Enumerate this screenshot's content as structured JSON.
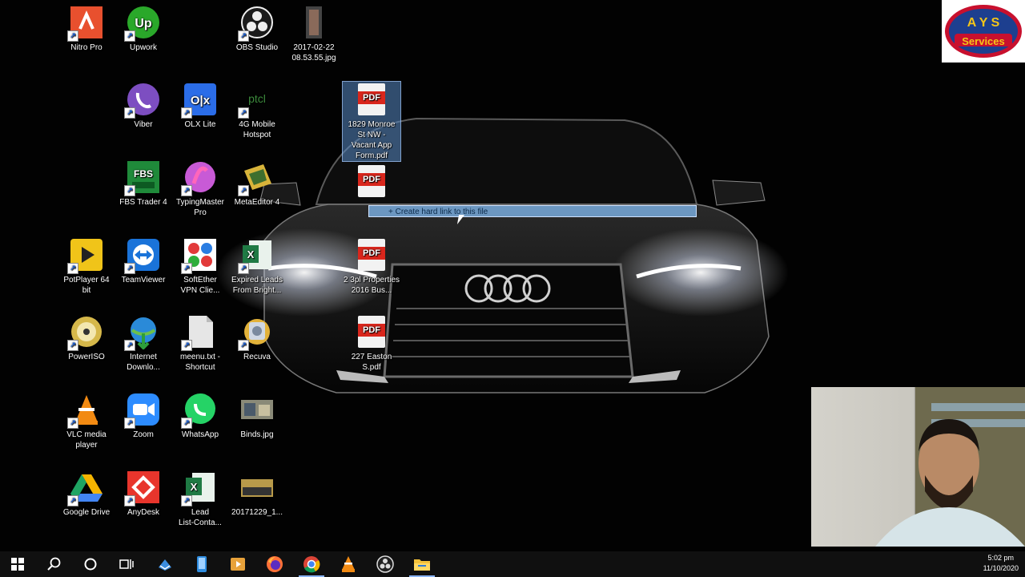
{
  "desktop": {
    "icons": [
      {
        "id": "nitro",
        "label": "Nitro Pro",
        "icon": "nitro-pro-icon",
        "color": "#e8502e"
      },
      {
        "id": "upwork",
        "label": "Upwork",
        "icon": "upwork-icon",
        "color": "#2aa82a"
      },
      {
        "id": "obs",
        "label": "OBS Studio",
        "icon": "obs-studio-icon",
        "color": "#1b1b1b"
      },
      {
        "id": "jpg2017",
        "label": "2017-02-22\n08.53.55.jpg",
        "icon": "image-thumbnail-icon",
        "color": "#444"
      },
      {
        "id": "viber",
        "label": "Viber",
        "icon": "viber-icon",
        "color": "#7d4ec1"
      },
      {
        "id": "olx",
        "label": "OLX Lite",
        "icon": "olx-icon",
        "color": "#2b6de8"
      },
      {
        "id": "ptcl",
        "label": "4G Mobile\nHotspot",
        "icon": "ptcl-hotspot-icon",
        "color": "#3c8a3c"
      },
      {
        "id": "pdf1829",
        "label": "1829 Monroe\nSt NW -\nVacant App\nForm.pdf",
        "icon": "pdf-icon",
        "color": "#d9261c"
      },
      {
        "id": "fbs",
        "label": "FBS Trader 4",
        "icon": "fbs-trader-icon",
        "color": "#1f8a3a"
      },
      {
        "id": "typing",
        "label": "TypingMaster\nPro",
        "icon": "typingmaster-icon",
        "color": "#c85ad6"
      },
      {
        "id": "metaeditor",
        "label": "MetaEditor 4",
        "icon": "metaeditor-icon",
        "color": "#d8b43a"
      },
      {
        "id": "pdf2",
        "label": "",
        "icon": "pdf-icon",
        "color": "#d9261c"
      },
      {
        "id": "potplayer",
        "label": "PotPlayer 64\nbit",
        "icon": "potplayer-icon",
        "color": "#f0c419"
      },
      {
        "id": "teamviewer",
        "label": "TeamViewer",
        "icon": "teamviewer-icon",
        "color": "#1a73d9"
      },
      {
        "id": "softether",
        "label": "SoftEther\nVPN Clie...",
        "icon": "softether-icon",
        "color": "#e23a3a"
      },
      {
        "id": "expired",
        "label": "Expired Leads\nFrom Bright...",
        "icon": "excel-icon",
        "color": "#1f7a44"
      },
      {
        "id": "pdf3",
        "label": "2 3pl Properties\n2016 Bus...",
        "icon": "pdf-icon",
        "color": "#d9261c"
      },
      {
        "id": "poweriso",
        "label": "PowerISO",
        "icon": "poweriso-icon",
        "color": "#d6b84a"
      },
      {
        "id": "idm",
        "label": "Internet\nDownlo...",
        "icon": "internet-download-manager-icon",
        "color": "#2a8ad8"
      },
      {
        "id": "meenu",
        "label": "meenu.txt -\nShortcut",
        "icon": "text-file-icon",
        "color": "#e6e6e6"
      },
      {
        "id": "recuva",
        "label": "Recuva",
        "icon": "recuva-icon",
        "color": "#e2b23a"
      },
      {
        "id": "pdf227",
        "label": "227 Easton\nS.pdf",
        "icon": "pdf-icon",
        "color": "#d9261c"
      },
      {
        "id": "vlc",
        "label": "VLC media\nplayer",
        "icon": "vlc-icon",
        "color": "#f28a12"
      },
      {
        "id": "zoom",
        "label": "Zoom",
        "icon": "zoom-icon",
        "color": "#2d8cff"
      },
      {
        "id": "whatsapp",
        "label": "WhatsApp",
        "icon": "whatsapp-icon",
        "color": "#25d366"
      },
      {
        "id": "binds",
        "label": "Binds.jpg",
        "icon": "image-thumbnail-icon",
        "color": "#8a8a78"
      },
      {
        "id": "gdrive",
        "label": "Google Drive",
        "icon": "google-drive-icon",
        "color": "#f5b400"
      },
      {
        "id": "anydesk",
        "label": "AnyDesk",
        "icon": "anydesk-icon",
        "color": "#e8352c"
      },
      {
        "id": "lead",
        "label": "Lead\nList-Conta...",
        "icon": "excel-icon",
        "color": "#1f7a44"
      },
      {
        "id": "jpg20171229",
        "label": "20171229_1...",
        "icon": "image-thumbnail-icon",
        "color": "#b89a4a"
      }
    ],
    "drag_tooltip": "+ Create hard link to this file",
    "logo_text": "Services"
  },
  "taskbar": {
    "items": [
      {
        "id": "start",
        "icon": "windows-start-icon"
      },
      {
        "id": "search",
        "icon": "search-icon"
      },
      {
        "id": "cortana",
        "icon": "cortana-circle-icon"
      },
      {
        "id": "taskview",
        "icon": "task-view-icon"
      },
      {
        "id": "azuredata",
        "icon": "app-icon"
      },
      {
        "id": "phone",
        "icon": "phone-app-icon"
      },
      {
        "id": "media",
        "icon": "media-player-icon"
      },
      {
        "id": "firefox",
        "icon": "firefox-icon"
      },
      {
        "id": "chrome",
        "icon": "chrome-icon"
      },
      {
        "id": "vlc",
        "icon": "vlc-icon"
      },
      {
        "id": "obs",
        "icon": "obs-studio-icon"
      },
      {
        "id": "explorer",
        "icon": "file-explorer-icon"
      }
    ],
    "clock": {
      "time": "5:02 pm",
      "date": "11/10/2020"
    }
  }
}
